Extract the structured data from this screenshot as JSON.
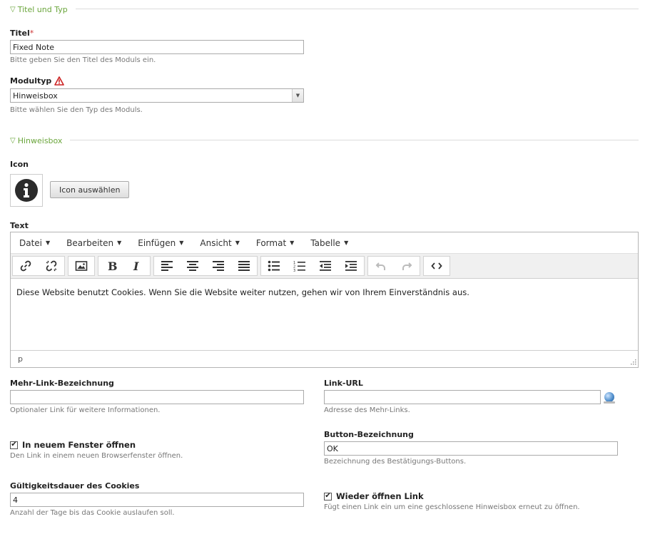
{
  "section1": {
    "legend": "Titel und Typ"
  },
  "title_field": {
    "label": "Titel",
    "required_mark": "*",
    "value": "Fixed Note",
    "tip": "Bitte geben Sie den Titel des Moduls ein."
  },
  "module_type": {
    "label": "Modultyp",
    "value": "Hinweisbox",
    "tip": "Bitte wählen Sie den Typ des Moduls."
  },
  "section2": {
    "legend": "Hinweisbox"
  },
  "icon_field": {
    "label": "Icon",
    "icon": "info-circle-icon",
    "button_label": "Icon auswählen"
  },
  "text_field": {
    "label": "Text",
    "menu": [
      "Datei",
      "Bearbeiten",
      "Einfügen",
      "Ansicht",
      "Format",
      "Tabelle"
    ],
    "content": "Diese Website benutzt Cookies. Wenn Sie die Website weiter nutzen, gehen wir von Ihrem Einverständnis aus.",
    "status_path": "p"
  },
  "more_link_label": {
    "label": "Mehr-Link-Bezeichnung",
    "value": "",
    "tip": "Optionaler Link für weitere Informationen."
  },
  "link_url": {
    "label": "Link-URL",
    "value": "",
    "tip": "Adresse des Mehr-Links."
  },
  "new_window": {
    "label": "In neuem Fenster öffnen",
    "checked": true,
    "tip": "Den Link in einem neuen Browserfenster öffnen."
  },
  "button_label": {
    "label": "Button-Bezeichnung",
    "value": "OK",
    "tip": "Bezeichnung des Bestätigungs-Buttons."
  },
  "cookie_duration": {
    "label": "Gültigkeitsdauer des Cookies",
    "value": "4",
    "tip": "Anzahl der Tage bis das Cookie auslaufen soll."
  },
  "reopen_link": {
    "label": "Wieder öffnen Link",
    "checked": true,
    "tip": "Fügt einen Link ein um eine geschlossene Hinweisbox erneut zu öffnen."
  },
  "colors": {
    "legend": "#6aa53b",
    "required": "#cc3333",
    "warning": "#cc2222"
  }
}
